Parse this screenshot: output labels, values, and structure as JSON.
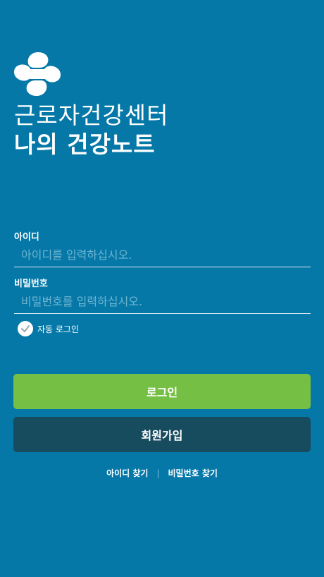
{
  "header": {
    "title_line1": "근로자건강센터",
    "title_line2": "나의 건강노트",
    "logo_icon": "cross-swirl-logo-icon"
  },
  "form": {
    "id_label": "아이디",
    "id_placeholder": "아이디를 입력하십시오.",
    "id_value": "",
    "pw_label": "비밀번호",
    "pw_placeholder": "비밀번호를 입력하십시오.",
    "pw_value": "",
    "auto_login_label": "자동 로그인",
    "auto_login_checked": true
  },
  "buttons": {
    "login": "로그인",
    "signup": "회원가입"
  },
  "links": {
    "find_id": "아이디 찾기",
    "separator": "|",
    "find_pw": "비밀번호 찾기"
  },
  "colors": {
    "background": "#0578A8",
    "login_button": "#76BF45",
    "signup_button": "#174B5E"
  }
}
